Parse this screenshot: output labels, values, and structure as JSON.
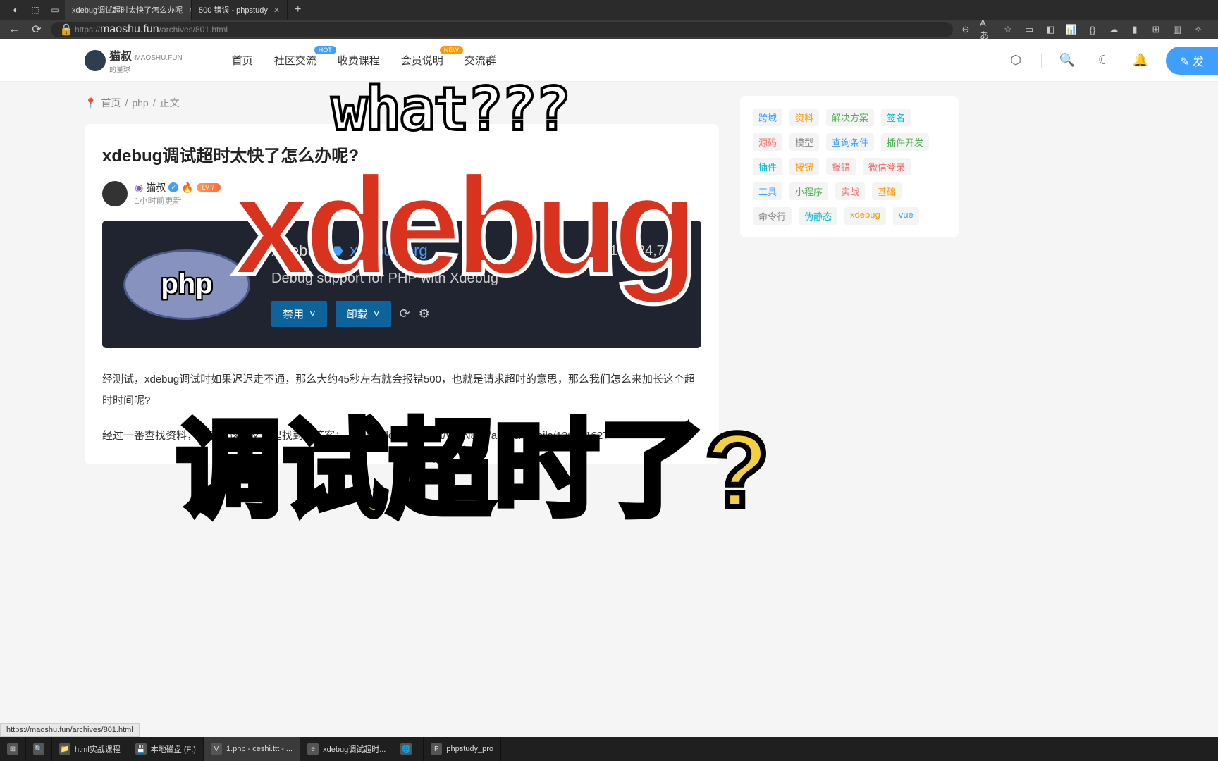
{
  "browser": {
    "tabs": [
      {
        "title": "xdebug调试超时太快了怎么办呢",
        "active": true
      },
      {
        "title": "500 错误 - phpstudy",
        "active": false
      }
    ],
    "url_prefix": "https://",
    "url_host": "maoshu.fun",
    "url_path": "/archives/801.html"
  },
  "header": {
    "logo_main": "猫叔",
    "logo_sub": "MAOSHU.FUN",
    "logo_tagline": "的星球",
    "nav": [
      {
        "label": "首页",
        "badge": ""
      },
      {
        "label": "社区交流",
        "badge": "HOT",
        "badge_class": "badge-hot"
      },
      {
        "label": "收费课程",
        "badge": ""
      },
      {
        "label": "会员说明",
        "badge": "NEW",
        "badge_class": "badge-new"
      },
      {
        "label": "交流群",
        "badge": ""
      }
    ],
    "publish": "发"
  },
  "breadcrumb": {
    "home": "首页",
    "category": "php",
    "current": "正文"
  },
  "article": {
    "title": "xdebug调试超时太快了怎么办呢?",
    "author": "猫叔",
    "level": "LV 7",
    "updated": "1小时前更新",
    "para1": "经测试，xdebug调试时如果迟迟走不通，那么大约45秒左右就会报错500，也就是请求超时的意思，那么我们怎么来加长这个超时时间呢?",
    "para2_pre": "经过一番查找资料，终于在这篇文章里找到了答案：",
    "para2_link": "https://blog.csdn.net/WXN889/article/details/126591627"
  },
  "extension": {
    "name": "Xdebug",
    "link": "xdebug.org",
    "downloads": "10,824,746",
    "description": "Debug support for PHP with Xdebug",
    "btn_disable": "禁用",
    "btn_uninstall": "卸载",
    "php_label": "php"
  },
  "tags": [
    {
      "label": "跨域",
      "class": "tag-blue"
    },
    {
      "label": "资料",
      "class": "tag-orange"
    },
    {
      "label": "解决方案",
      "class": "tag-green"
    },
    {
      "label": "签名",
      "class": "tag-cyan"
    },
    {
      "label": "源码",
      "class": "tag-red"
    },
    {
      "label": "模型",
      "class": "tag-gray"
    },
    {
      "label": "查询条件",
      "class": "tag-blue"
    },
    {
      "label": "插件开发",
      "class": "tag-green"
    },
    {
      "label": "插件",
      "class": "tag-cyan"
    },
    {
      "label": "按钮",
      "class": "tag-orange"
    },
    {
      "label": "报错",
      "class": "tag-red"
    },
    {
      "label": "微信登录",
      "class": "tag-red"
    },
    {
      "label": "工具",
      "class": "tag-blue"
    },
    {
      "label": "小程序",
      "class": "tag-green"
    },
    {
      "label": "实战",
      "class": "tag-red"
    },
    {
      "label": "基础",
      "class": "tag-orange"
    },
    {
      "label": "命令行",
      "class": "tag-gray"
    },
    {
      "label": "伪静态",
      "class": "tag-cyan"
    },
    {
      "label": "xdebug",
      "class": "tag-orange"
    },
    {
      "label": "vue",
      "class": "tag-blue"
    }
  ],
  "overlays": {
    "what": "what???",
    "xdebug": "xdebug",
    "timeout": "调试超时了?"
  },
  "status_url": "https://maoshu.fun/archives/801.html",
  "taskbar": [
    {
      "label": "html实战课程",
      "icon": "📁"
    },
    {
      "label": "本地磁盘 (F:)",
      "icon": "💾"
    },
    {
      "label": "1.php - ceshi.ttt - ...",
      "icon": "V",
      "active": true
    },
    {
      "label": "xdebug调试超时...",
      "icon": "e"
    },
    {
      "label": "",
      "icon": "🌐"
    },
    {
      "label": "phpstudy_pro",
      "icon": "P"
    }
  ]
}
